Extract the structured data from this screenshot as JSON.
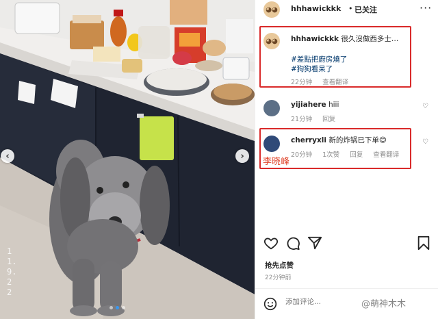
{
  "post": {
    "username": "hhhawickkk",
    "separator": "•",
    "follow_status": "已关注",
    "more_label": "···"
  },
  "comments": [
    {
      "username": "hhhawickkk",
      "line1": "很久沒做西多士…",
      "line2": "#差點把廚房燒了",
      "line3": "#狗狗看呆了",
      "time": "22分钟",
      "translate": "查看翻译"
    },
    {
      "username": "yijiahere",
      "text": "hiii",
      "time": "21分钟",
      "reply": "回复"
    },
    {
      "username": "cherryxli",
      "text": "新的炸锅已下单😊",
      "time": "20分钟",
      "likes": "1次赞",
      "reply": "回复",
      "translate": "查看翻译"
    }
  ],
  "annotation": {
    "name": "李晓峰",
    "highlight_color": "#d92a2a",
    "name_color": "#e0452c"
  },
  "actions": {
    "icons": [
      "heart-icon",
      "comment-icon",
      "share-icon",
      "bookmark-icon"
    ],
    "likes_text": "抢先点赞",
    "time": "22分钟前"
  },
  "add_comment": {
    "placeholder": "添加评论..."
  },
  "watermark": "@萌神木木",
  "photo": {
    "carousel_dots": 3,
    "active_dot": 1,
    "stamp": "11.9.22"
  },
  "colors": {
    "link": "#00376b",
    "meta": "#8e8e8e",
    "accent_dot": "#3897f0"
  }
}
